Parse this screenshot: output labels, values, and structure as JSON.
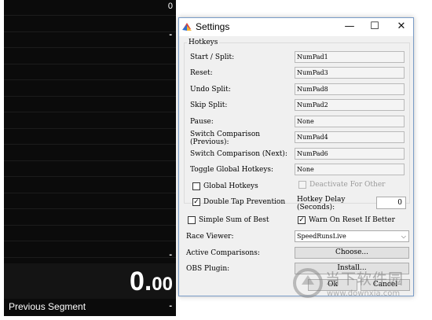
{
  "timer_window": {
    "split_first_value": "0",
    "split_dash_top": "-",
    "split_dash_bottom": "-",
    "timer_main": "0.",
    "timer_fraction": "00",
    "previous_segment_label": "Previous Segment",
    "previous_segment_value": "-"
  },
  "settings": {
    "title": "Settings",
    "minimize": "—",
    "maximize": "☐",
    "close": "✕",
    "hotkeys_legend": "Hotkeys",
    "hotkeys": [
      {
        "label": "Start / Split:",
        "value": "NumPad1"
      },
      {
        "label": "Reset:",
        "value": "NumPad3"
      },
      {
        "label": "Undo Split:",
        "value": "NumPad8"
      },
      {
        "label": "Skip Split:",
        "value": "NumPad2"
      },
      {
        "label": "Pause:",
        "value": "None"
      },
      {
        "label": "Switch Comparison\n(Previous):",
        "value": "NumPad4"
      },
      {
        "label": "Switch Comparison (Next):",
        "value": "NumPad6"
      },
      {
        "label": "Toggle Global Hotkeys:",
        "value": "None"
      }
    ],
    "global_hotkeys_label": "Global Hotkeys",
    "deactivate_label": "Deactivate For Other",
    "double_tap_label": "Double Tap Prevention",
    "hotkey_delay_label": "Hotkey Delay\n(Seconds):",
    "hotkey_delay_value": "0",
    "simple_sum_label": "Simple Sum of Best",
    "warn_reset_label": "Warn On Reset If Better",
    "race_viewer_label": "Race Viewer:",
    "race_viewer_value": "SpeedRunsLive",
    "active_comparisons_label": "Active Comparisons:",
    "choose_button": "Choose...",
    "obs_plugin_label": "OBS Plugin:",
    "install_button": "Install...",
    "ok_button": "Ok",
    "cancel_button": "Cancel",
    "checked_mark": "✓"
  },
  "watermark": {
    "text_cn": "当下软件园",
    "url": "www.downxia.com"
  },
  "colors": {
    "timer_bg": "#0b0b0b",
    "dialog_bg": "#f0f0f0",
    "dialog_border": "#7a9cc7"
  }
}
